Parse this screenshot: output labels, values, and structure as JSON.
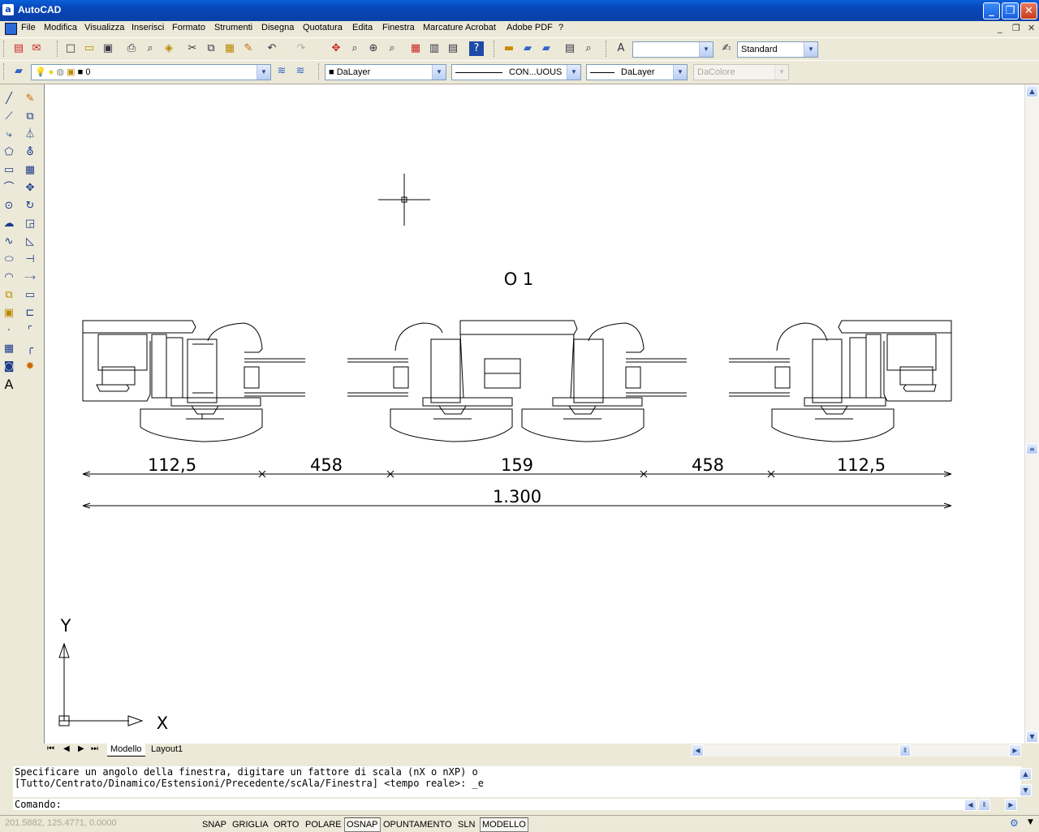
{
  "window": {
    "title": "AutoCAD",
    "app_icon_letter": "a"
  },
  "menu": {
    "items": [
      "File",
      "Modifica",
      "Visualizza",
      "Inserisci",
      "Formato",
      "Strumenti",
      "Disegna",
      "Quotatura",
      "Edita",
      "Finestra",
      "Marcature Acrobat",
      "Adobe PDF",
      "?"
    ]
  },
  "toolbar": {
    "text_style_value": "",
    "dim_style_value": "Standard",
    "layer_value": "0",
    "color_value": "DaLayer",
    "linetype_value": "CON...UOUS",
    "lineweight_value": "DaLayer",
    "plotstyle_value": "DaColore"
  },
  "drawing": {
    "label": "O 1",
    "dims": [
      "112,5",
      "458",
      "159",
      "458",
      "112,5"
    ],
    "total": "1.300",
    "ucs_x": "X",
    "ucs_y": "Y"
  },
  "tabs": {
    "model": "Modello",
    "layout1": "Layout1"
  },
  "command": {
    "line1": "Specificare un angolo della finestra, digitare un fattore di scala (nX o nXP) o",
    "line2": "[Tutto/Centrato/Dinamico/Estensioni/Precedente/scAla/Finestra] <tempo reale>: _e",
    "prompt": "Comando:"
  },
  "status": {
    "coords": "201.5882, 125.4771, 0.0000",
    "buttons": [
      "SNAP",
      "GRIGLIA",
      "ORTO",
      "POLARE",
      "OSNAP",
      "OPUNTAMENTO",
      "SLN",
      "MODELLO"
    ]
  }
}
